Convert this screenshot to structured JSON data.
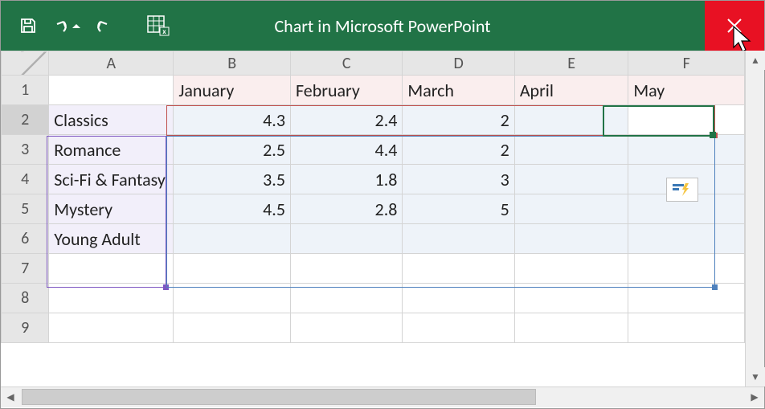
{
  "title": "Chart in Microsoft PowerPoint",
  "columns": [
    "A",
    "B",
    "C",
    "D",
    "E",
    "F"
  ],
  "row_numbers": [
    1,
    2,
    3,
    4,
    5,
    6,
    7,
    8,
    9
  ],
  "active_row": 2,
  "selected_cell": "F2",
  "header_row": {
    "A": "",
    "B": "January",
    "C": "February",
    "D": "March",
    "E": "April",
    "F": "May"
  },
  "data_rows": [
    {
      "label": "Classics",
      "B": "4.3",
      "C": "2.4",
      "D": "2",
      "E": "",
      "F": ""
    },
    {
      "label": "Romance",
      "B": "2.5",
      "C": "4.4",
      "D": "2",
      "E": "",
      "F": ""
    },
    {
      "label": "Sci-Fi & Fantasy",
      "B": "3.5",
      "C": "1.8",
      "D": "3",
      "E": "",
      "F": ""
    },
    {
      "label": "Mystery",
      "B": "4.5",
      "C": "2.8",
      "D": "5",
      "E": "",
      "F": ""
    },
    {
      "label": "Young Adult",
      "B": "",
      "C": "",
      "D": "",
      "E": "",
      "F": ""
    }
  ],
  "chart_data": {
    "type": "bar",
    "categories": [
      "Classics",
      "Romance",
      "Sci-Fi & Fantasy",
      "Mystery",
      "Young Adult"
    ],
    "series": [
      {
        "name": "January",
        "values": [
          4.3,
          2.5,
          3.5,
          4.5,
          null
        ]
      },
      {
        "name": "February",
        "values": [
          2.4,
          4.4,
          1.8,
          2.8,
          null
        ]
      },
      {
        "name": "March",
        "values": [
          2,
          2,
          3,
          5,
          null
        ]
      },
      {
        "name": "April",
        "values": [
          null,
          null,
          null,
          null,
          null
        ]
      },
      {
        "name": "May",
        "values": [
          null,
          null,
          null,
          null,
          null
        ]
      }
    ],
    "title": "",
    "xlabel": "",
    "ylabel": ""
  }
}
